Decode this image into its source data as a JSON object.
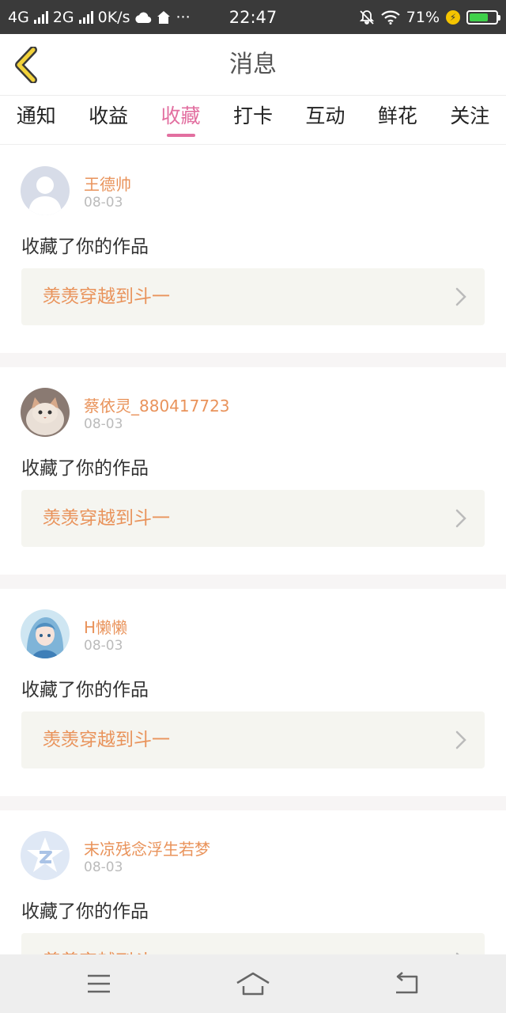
{
  "status_bar": {
    "net1": "4G",
    "net2": "2G",
    "speed": "0K/s",
    "time": "22:47",
    "more": "···",
    "battery": "71%",
    "battery_fill": 0.71,
    "battery_color": "#3fd14a"
  },
  "header": {
    "title": "消息",
    "back_icon": "chevron-left-icon"
  },
  "tabs": [
    {
      "label": "通知",
      "active": false
    },
    {
      "label": "收益",
      "active": false
    },
    {
      "label": "收藏",
      "active": true
    },
    {
      "label": "打卡",
      "active": false
    },
    {
      "label": "互动",
      "active": false
    },
    {
      "label": "鲜花",
      "active": false
    },
    {
      "label": "关注",
      "active": false
    }
  ],
  "accent_color": "#e26fa0",
  "username_color": "#e9935b",
  "notifications": [
    {
      "username": "王德帅",
      "date": "08-03",
      "action": "收藏了你的作品",
      "work_title": "羡羡穿越到斗一",
      "avatar": "default-person-avatar"
    },
    {
      "username": "蔡依灵_880417723",
      "date": "08-03",
      "action": "收藏了你的作品",
      "work_title": "羡羡穿越到斗一",
      "avatar": "kitten-photo-avatar"
    },
    {
      "username": "H懒懒",
      "date": "08-03",
      "action": "收藏了你的作品",
      "work_title": "羡羡穿越到斗一",
      "avatar": "anime-girl-avatar"
    },
    {
      "username": "末凉残念浮生若梦",
      "date": "08-03",
      "action": "收藏了你的作品",
      "work_title": "羡羡穿越到斗一",
      "avatar": "qq-logo-avatar"
    }
  ],
  "nav_bar": {
    "menu_icon": "menu-icon",
    "home_icon": "home-icon",
    "back_icon": "back-arrow-icon"
  }
}
